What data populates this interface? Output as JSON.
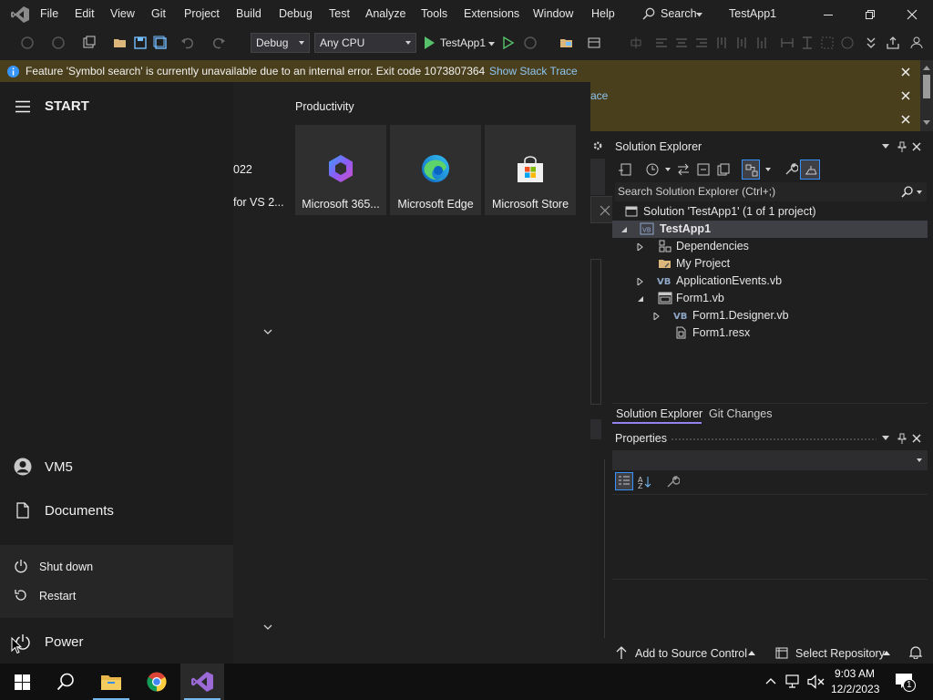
{
  "menubar": {
    "items": [
      "File",
      "Edit",
      "View",
      "Git",
      "Project",
      "Build",
      "Debug",
      "Test",
      "Analyze",
      "Tools",
      "Extensions",
      "Window",
      "Help"
    ],
    "search_label": "Search",
    "solution_name": "TestApp1"
  },
  "toolbar": {
    "config": "Debug",
    "platform": "Any CPU",
    "run_label": "TestApp1"
  },
  "infobar": {
    "message": "Feature 'Symbol search' is currently unavailable due to an internal error. Exit code 1073807364",
    "link": "Show Stack Trace",
    "partial_link": "ace"
  },
  "solution_explorer": {
    "title": "Solution Explorer",
    "search_placeholder": "Search Solution Explorer (Ctrl+;)",
    "solution_label": "Solution 'TestApp1' (1 of 1 project)",
    "project": "TestApp1",
    "items": [
      {
        "label": "Dependencies"
      },
      {
        "label": "My Project"
      },
      {
        "label": "ApplicationEvents.vb"
      },
      {
        "label": "Form1.vb"
      },
      {
        "label": "Form1.Designer.vb"
      },
      {
        "label": "Form1.resx"
      }
    ],
    "tabs": [
      "Solution Explorer",
      "Git Changes"
    ]
  },
  "properties": {
    "title": "Properties"
  },
  "statusbar": {
    "source_control": "Add to Source Control",
    "repository": "Select Repository"
  },
  "start_menu": {
    "title": "START",
    "section": "Productivity",
    "partial_texts": [
      "022",
      "for VS 2..."
    ],
    "tiles": [
      {
        "label": "Microsoft 365..."
      },
      {
        "label": "Microsoft Edge"
      },
      {
        "label": "Microsoft Store"
      }
    ],
    "user": "VM5",
    "documents": "Documents",
    "power_options": [
      "Shut down",
      "Restart"
    ],
    "power": "Power"
  },
  "taskbar": {
    "time": "9:03 AM",
    "date": "12/2/2023",
    "notification_count": "1"
  },
  "colors": {
    "accent_vs": "#9b6ad6",
    "infobar": "#4a3f1c",
    "selection": "#3f3f46",
    "taskbar": "#101010"
  }
}
